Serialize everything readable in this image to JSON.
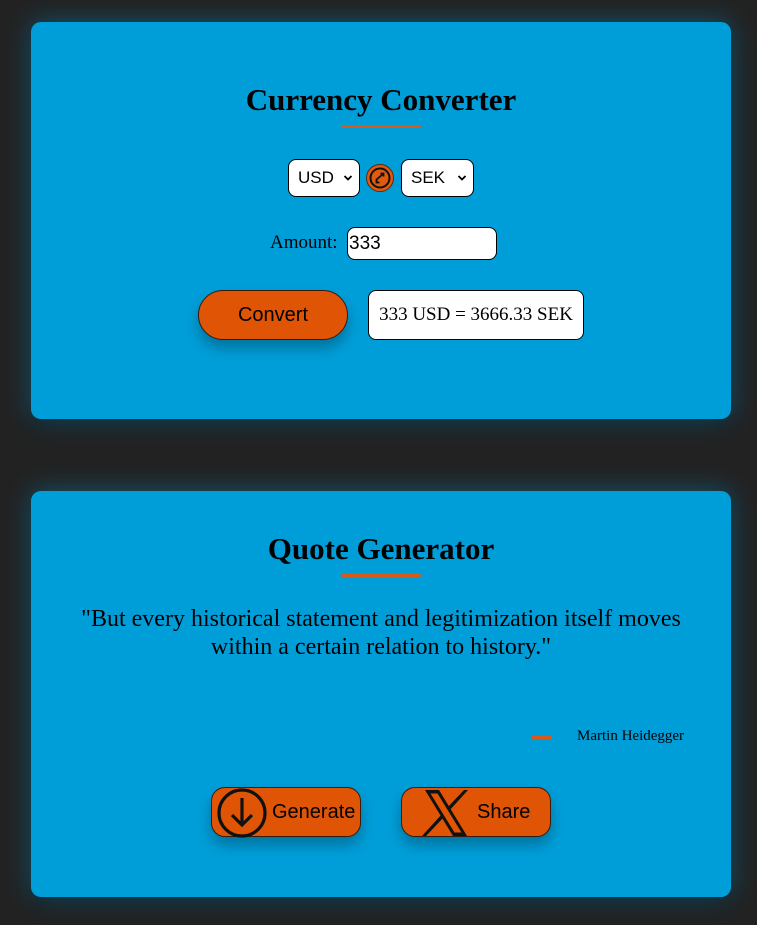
{
  "currency": {
    "title": "Currency Converter",
    "from_currency": "USD",
    "to_currency": "SEK",
    "amount_label": "Amount:",
    "amount_value": "333",
    "convert_label": "Convert",
    "result_text": "333 USD = 3666.33 SEK"
  },
  "quote": {
    "title": "Quote Generator",
    "text": "\"But every historical statement and legitimization itself moves within a certain relation to history.\"",
    "author": "Martin Heidegger",
    "generate_label": "Generate",
    "share_label": "Share"
  },
  "icons": {
    "swap": "swap-arrows-icon",
    "generate": "download-circle-icon",
    "share": "x-logo-icon",
    "dropdown": "chevron-down-icon"
  },
  "colors": {
    "page_background": "#222222",
    "card_background": "#009ed9",
    "accent": "#e05406",
    "underline": "#d85a1a"
  }
}
